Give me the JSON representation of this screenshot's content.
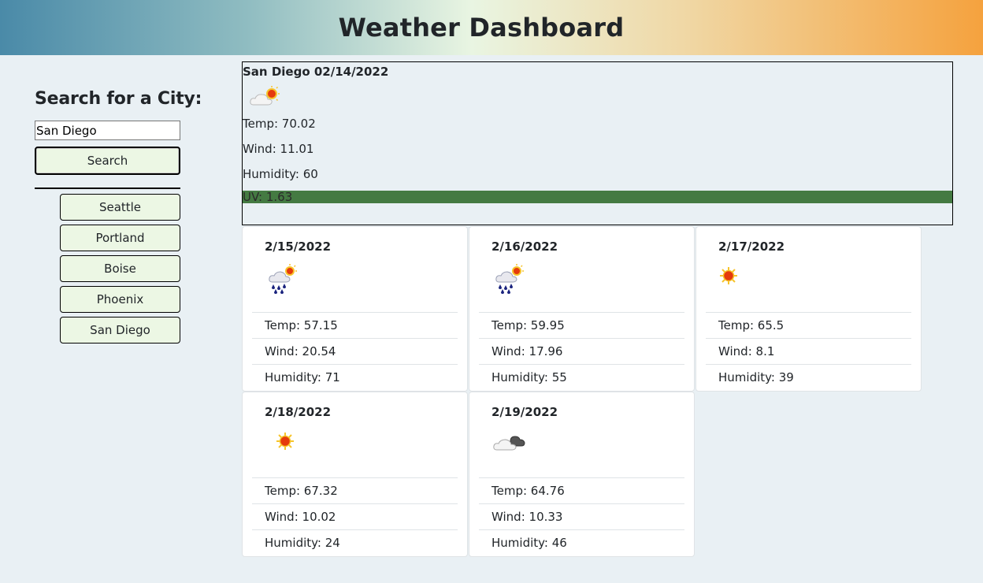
{
  "header": {
    "title": "Weather Dashboard"
  },
  "search": {
    "heading": "Search for a City:",
    "input_value": "San Diego",
    "button_label": "Search"
  },
  "history": [
    {
      "label": "Seattle"
    },
    {
      "label": "Portland"
    },
    {
      "label": "Boise"
    },
    {
      "label": "Phoenix"
    },
    {
      "label": "San Diego"
    }
  ],
  "current": {
    "title": "San Diego 02/14/2022",
    "icon": "partly-cloudy-icon",
    "temp": "Temp: 70.02",
    "wind": "Wind: 11.01",
    "humidity": "Humidity: 60",
    "uv": "UV: 1.63",
    "uv_color": "#447a42"
  },
  "forecast": [
    {
      "date": "2/15/2022",
      "icon": "rain-sun-icon",
      "temp": "Temp: 57.15",
      "wind": "Wind: 20.54",
      "humidity": "Humidity: 71"
    },
    {
      "date": "2/16/2022",
      "icon": "rain-sun-icon",
      "temp": "Temp: 59.95",
      "wind": "Wind: 17.96",
      "humidity": "Humidity: 55"
    },
    {
      "date": "2/17/2022",
      "icon": "sun-icon",
      "temp": "Temp: 65.5",
      "wind": "Wind: 8.1",
      "humidity": "Humidity: 39"
    },
    {
      "date": "2/18/2022",
      "icon": "sun-icon",
      "temp": "Temp: 67.32",
      "wind": "Wind: 10.02",
      "humidity": "Humidity: 24"
    },
    {
      "date": "2/19/2022",
      "icon": "cloudy-icon",
      "temp": "Temp: 64.76",
      "wind": "Wind: 10.33",
      "humidity": "Humidity: 46"
    }
  ],
  "colors": {
    "page_bg": "#e9f0f4",
    "button_bg": "#ecf7e4",
    "header_gradient": [
      "#4a8aa8",
      "#e9f5e2",
      "#f5a23e"
    ]
  }
}
